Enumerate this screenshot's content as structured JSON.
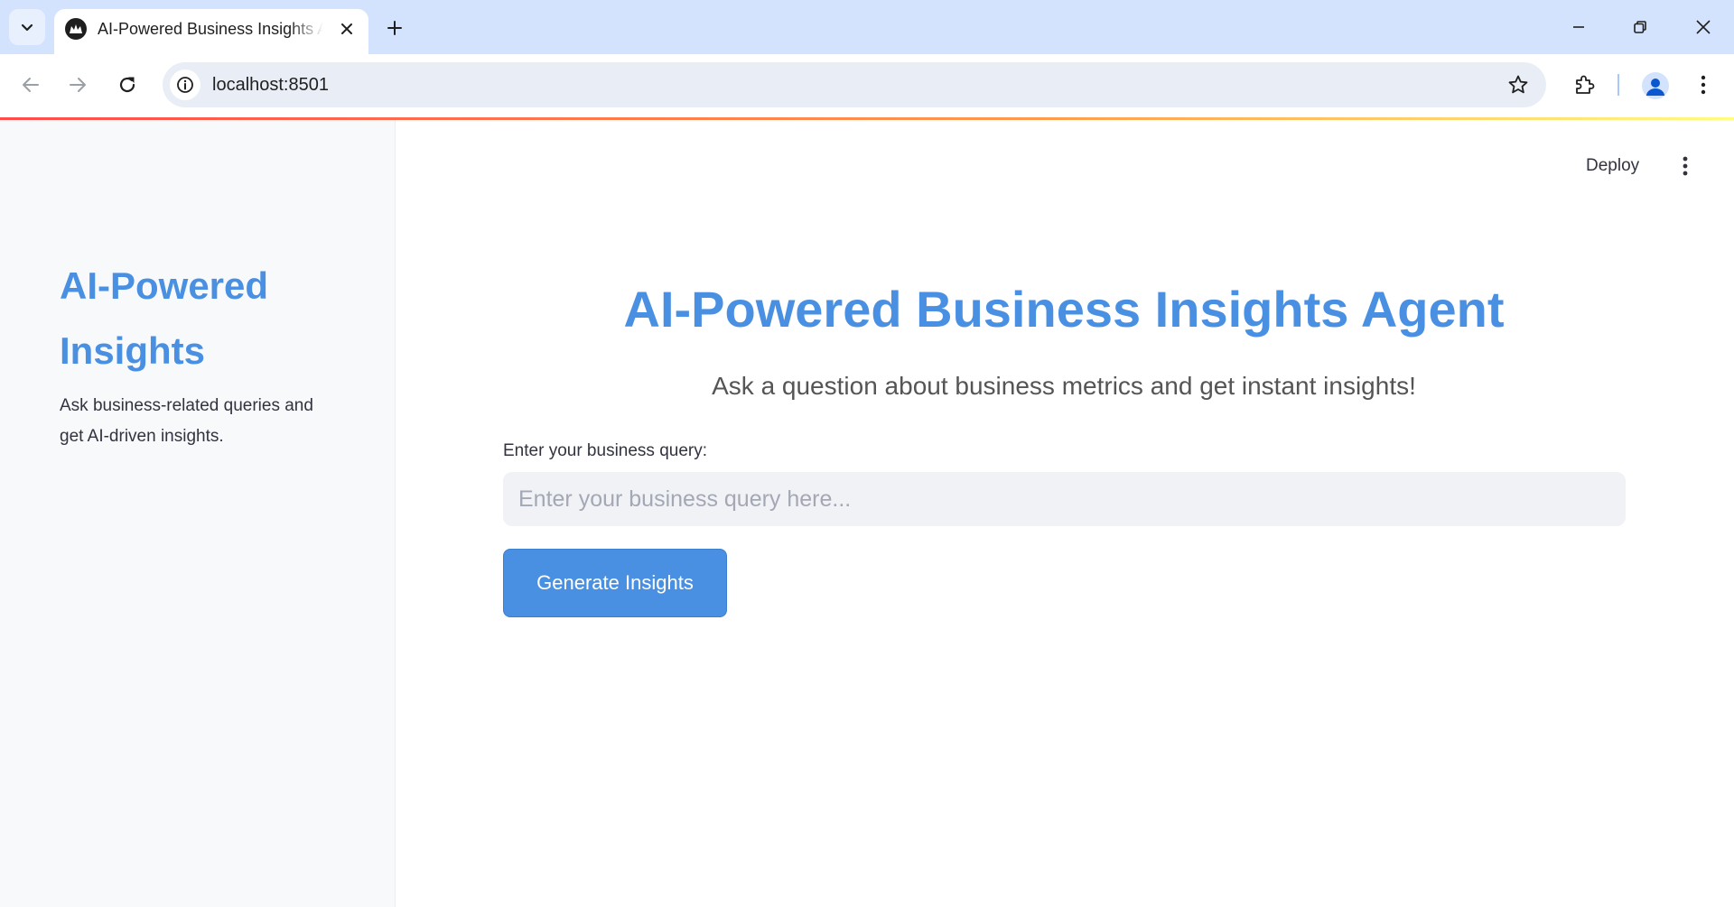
{
  "browser": {
    "tab_title": "AI-Powered Business Insights Agent",
    "url": "localhost:8501"
  },
  "app": {
    "deploy_label": "Deploy",
    "sidebar": {
      "title": "AI-Powered Insights",
      "description": "Ask business-related queries and get AI-driven insights."
    },
    "main": {
      "title": "AI-Powered Business Insights Agent",
      "subtitle": "Ask a question about business metrics and get instant insights!",
      "query_label": "Enter your business query:",
      "query_placeholder": "Enter your business query here...",
      "query_value": "",
      "button_label": "Generate Insights"
    }
  },
  "colors": {
    "accent": "#4a90e2",
    "sidebar_bg": "#f8f9fb",
    "input_bg": "#f0f2f6",
    "tabbar_bg": "#d3e3fd"
  }
}
